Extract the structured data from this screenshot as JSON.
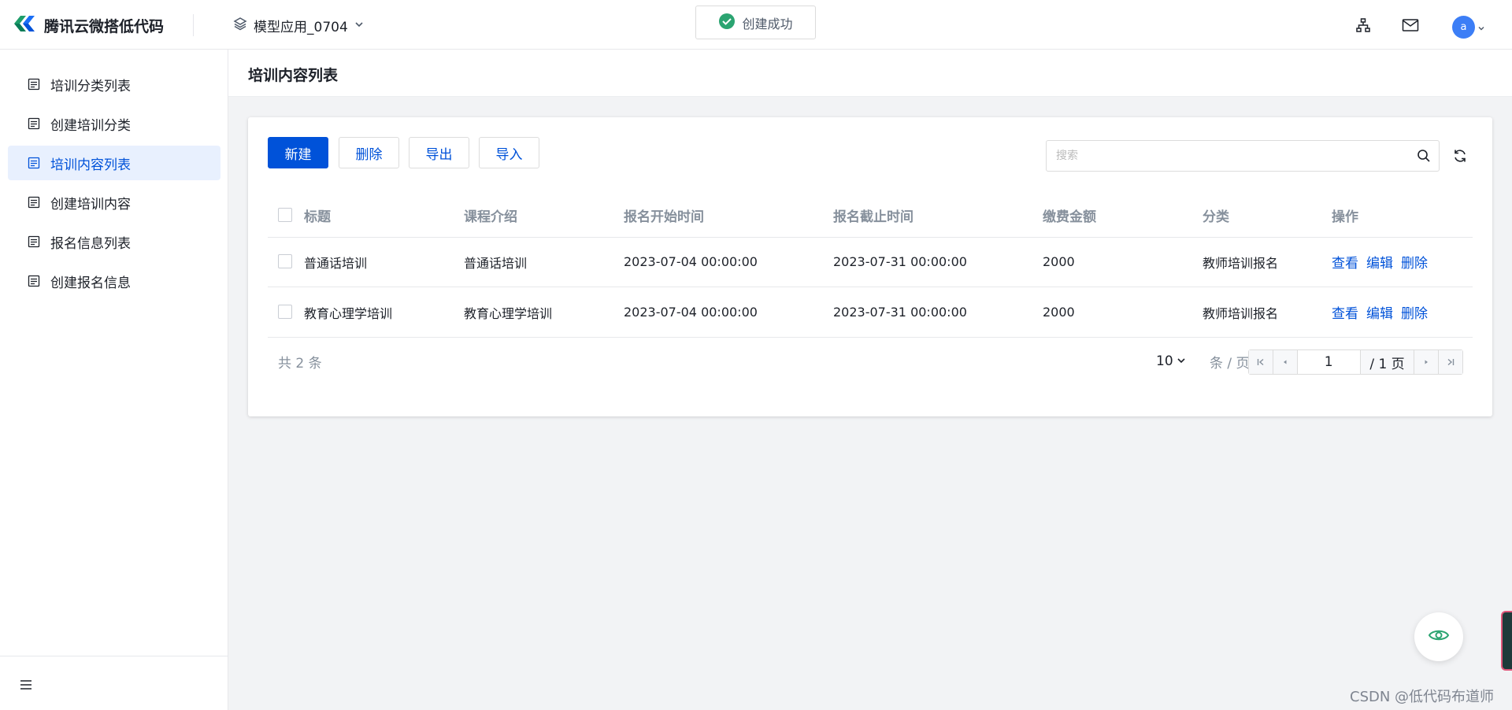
{
  "header": {
    "brand_name": "腾讯云微搭低代码",
    "app_name": "模型应用_0704",
    "toast_text": "创建成功",
    "avatar_letter": "a"
  },
  "sidebar": {
    "items": [
      {
        "label": "培训分类列表"
      },
      {
        "label": "创建培训分类"
      },
      {
        "label": "培训内容列表",
        "active": true
      },
      {
        "label": "创建培训内容"
      },
      {
        "label": "报名信息列表"
      },
      {
        "label": "创建报名信息"
      }
    ]
  },
  "page": {
    "title": "培训内容列表"
  },
  "toolbar": {
    "new_label": "新建",
    "delete_label": "删除",
    "export_label": "导出",
    "import_label": "导入",
    "search_placeholder": "搜索"
  },
  "table": {
    "headers": [
      "标题",
      "课程介绍",
      "报名开始时间",
      "报名截止时间",
      "缴费金额",
      "分类",
      "操作"
    ],
    "rows": [
      {
        "title": "普通话培训",
        "intro": "普通话培训",
        "start": "2023-07-04 00:00:00",
        "end": "2023-07-31 00:00:00",
        "fee": "2000",
        "category": "教师培训报名"
      },
      {
        "title": "教育心理学培训",
        "intro": "教育心理学培训",
        "start": "2023-07-04 00:00:00",
        "end": "2023-07-31 00:00:00",
        "fee": "2000",
        "category": "教师培训报名"
      }
    ],
    "actions": {
      "view": "查看",
      "edit": "编辑",
      "delete": "删除"
    }
  },
  "pagination": {
    "total_text": "共 2 条",
    "page_size": "10",
    "per_page_text": "条 / 页",
    "current_page": "1",
    "total_pages_text": "/ 1 页"
  },
  "watermark": "CSDN @低代码布道师",
  "colors": {
    "primary": "#0052d9",
    "success": "#2ba471",
    "avatar": "#3c7ef6"
  }
}
